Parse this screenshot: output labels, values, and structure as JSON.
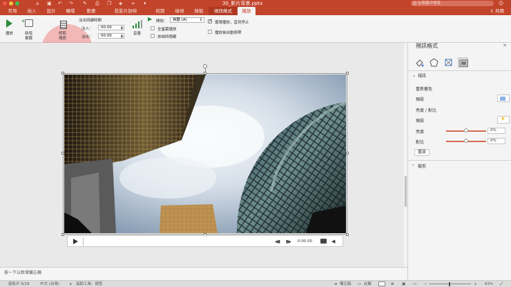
{
  "title_bar": {
    "document_title": "30_影片背景.pptx",
    "search_placeholder": "在簡報中搜尋",
    "icons": [
      "home-icon",
      "save-icon",
      "undo-icon",
      "redo-icon",
      "format-painter-icon",
      "print-icon",
      "more-icon"
    ]
  },
  "ribbon_tabs": [
    {
      "label": "常用"
    },
    {
      "label": "插入"
    },
    {
      "label": "設計"
    },
    {
      "label": "轉場"
    },
    {
      "label": "動畫"
    },
    {
      "label": "投影片放映"
    },
    {
      "label": "校閱"
    },
    {
      "label": "檢視"
    },
    {
      "label": "錄製"
    },
    {
      "label": "視訊格式"
    },
    {
      "label": "播放"
    }
  ],
  "active_tab": "播放",
  "share_label": "共用",
  "ribbon": {
    "play_label": "播放",
    "add_bookmark_label": "新增書籤",
    "trim_label": "修剪視訊",
    "fade_label": "淡出持續時間",
    "fade_in_label": "淡入：",
    "fade_in_value": "00.00",
    "fade_out_label": "淡出：",
    "fade_out_value": "00.00",
    "volume_label": "音量",
    "start_label": "開始：",
    "start_value": "自動 (A)",
    "fullscreen_label": "全螢幕播放",
    "hide_label": "放映時隱藏",
    "loop_label": "循環播放，直到停止",
    "rewind_label": "播放後自動倒帶",
    "loop_checked": true
  },
  "player": {
    "time": "0:00.00"
  },
  "notes_placeholder": "按一下以新增備忘稿",
  "pane": {
    "title": "視訊格式",
    "video_section": "視訊",
    "recolor_label": "重新著色",
    "preset_label": "預設",
    "brightness_contrast_label": "亮度 / 對比",
    "preset2_label": "預設",
    "brightness_label": "亮度",
    "brightness_value": "0%",
    "contrast_label": "對比",
    "contrast_value": "0%",
    "reset_label": "重設",
    "crop_section": "裁剪",
    "slider_levels": {
      "brightness": 0.5,
      "contrast": 0.5
    }
  },
  "status": {
    "slide_info": "投影片 9/18",
    "language": "中文 (台灣)",
    "accessibility": "協助工具：調查",
    "notes_btn": "備忘稿",
    "comments_btn": "註解",
    "zoom": "83%"
  },
  "colors": {
    "accent": "#c2442a",
    "play_green": "#2c8a3a",
    "slider": "#d16a4f"
  }
}
